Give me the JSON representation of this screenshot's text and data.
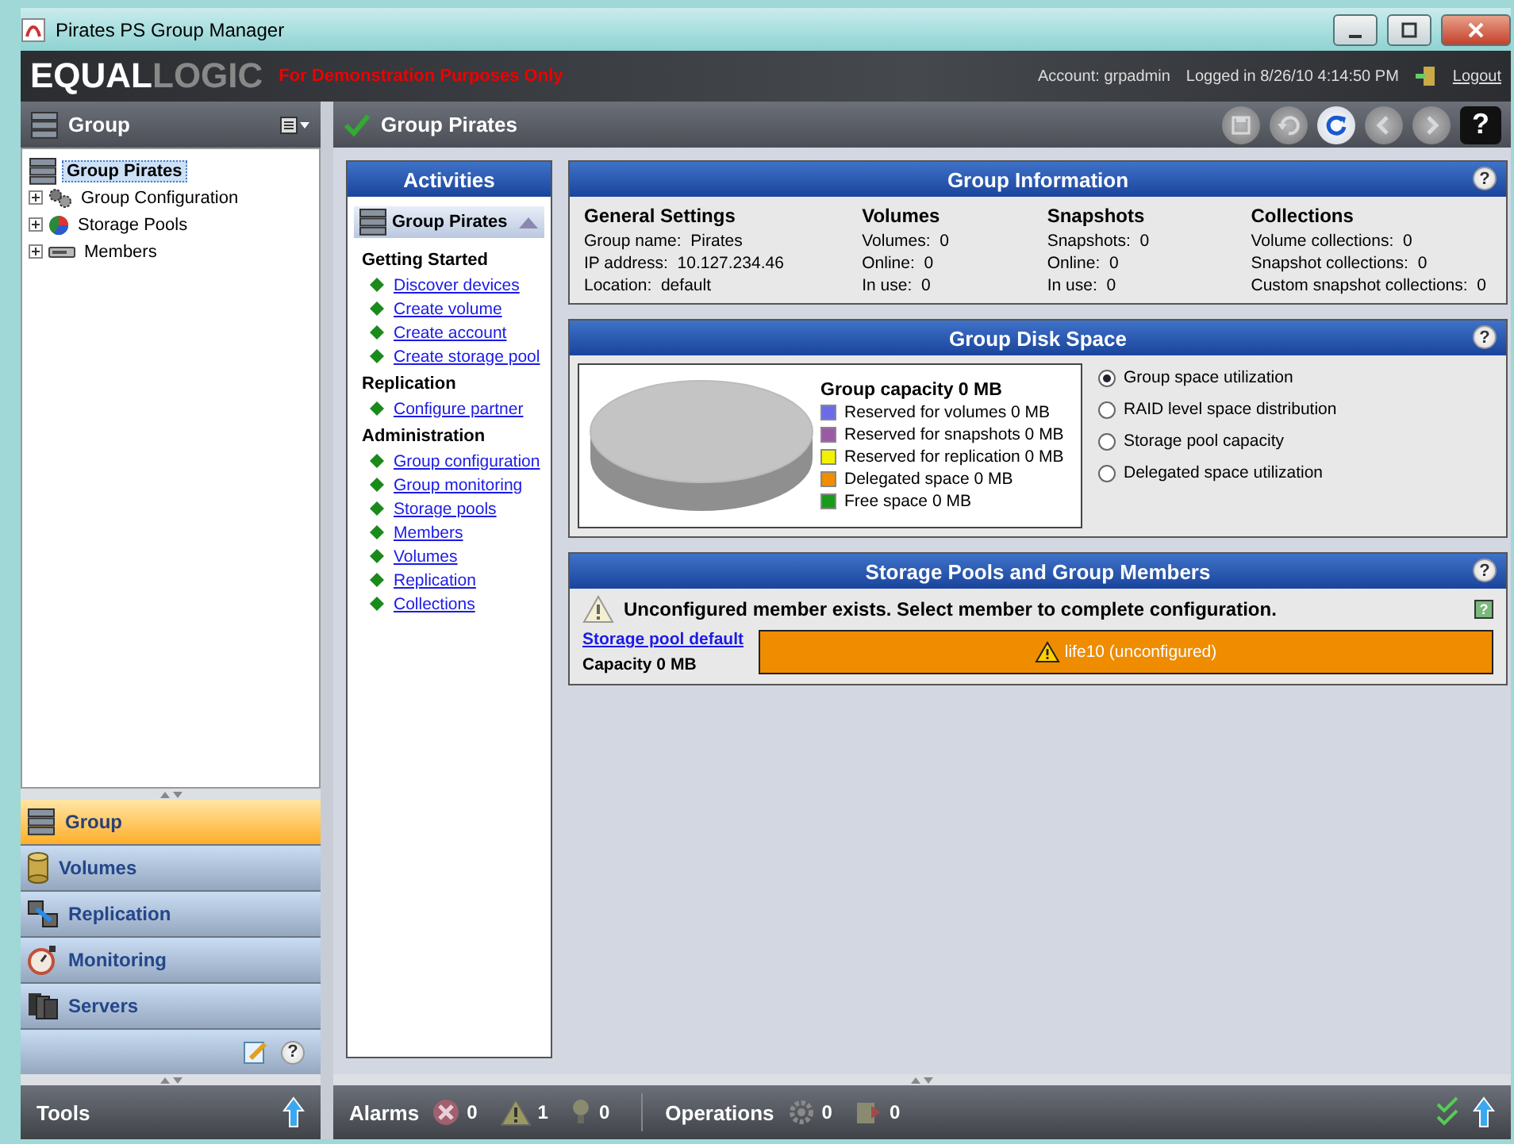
{
  "window": {
    "title": "Pirates PS Group Manager"
  },
  "brand": {
    "logo": [
      "EQUAL",
      "LOGIC"
    ],
    "notice": "For Demonstration Purposes Only",
    "account": "Account: grpadmin",
    "logged_in": "Logged in 8/26/10 4:14:50 PM",
    "logout": "Logout"
  },
  "left_header": {
    "title": "Group"
  },
  "tree": {
    "label": "Group Pirates",
    "selected": true,
    "children": [
      {
        "label": "Group Configuration",
        "kind": "configuration",
        "expanded": false
      },
      {
        "label": "Storage Pools",
        "kind": "pools",
        "expanded": false
      },
      {
        "label": "Members",
        "kind": "members",
        "expanded": false
      }
    ]
  },
  "nav": [
    {
      "label": "Group",
      "kind": "group",
      "selected": true
    },
    {
      "label": "Volumes",
      "kind": "volumes",
      "selected": false
    },
    {
      "label": "Replication",
      "kind": "replication",
      "selected": false
    },
    {
      "label": "Monitoring",
      "kind": "monitoring",
      "selected": false
    },
    {
      "label": "Servers",
      "kind": "servers",
      "selected": false
    }
  ],
  "tools": {
    "label": "Tools",
    "help": "?"
  },
  "content_header": {
    "title": "Group Pirates"
  },
  "toolbar": [
    {
      "kind": "save",
      "disabled": true
    },
    {
      "kind": "undo",
      "disabled": true
    },
    {
      "kind": "refresh",
      "disabled": false
    },
    {
      "kind": "back",
      "disabled": true
    },
    {
      "kind": "forward",
      "disabled": true
    },
    {
      "kind": "help",
      "disabled": false,
      "label": "?"
    }
  ],
  "activities": {
    "title": "Activities",
    "group": "Group Pirates",
    "sections": [
      {
        "heading": "Getting Started",
        "links": [
          "Discover devices",
          "Create volume",
          "Create account",
          "Create storage pool"
        ]
      },
      {
        "heading": "Replication",
        "links": [
          "Configure partner"
        ]
      },
      {
        "heading": "Administration",
        "links": [
          "Group configuration",
          "Group monitoring",
          "Storage pools",
          "Members",
          "Volumes",
          "Replication",
          "Collections"
        ]
      }
    ]
  },
  "group_information": {
    "title": "Group Information",
    "help": "?",
    "columns": [
      {
        "heading": "General Settings",
        "rows": [
          {
            "label": "Group name:",
            "value": "Pirates"
          },
          {
            "label": "IP address:",
            "value": "10.127.234.46"
          },
          {
            "label": "Location:",
            "value": "default"
          }
        ]
      },
      {
        "heading": "Volumes",
        "rows": [
          {
            "label": "Volumes:",
            "value": "0"
          },
          {
            "label": "Online:",
            "value": "0"
          },
          {
            "label": "In use:",
            "value": "0"
          }
        ]
      },
      {
        "heading": "Snapshots",
        "rows": [
          {
            "label": "Snapshots:",
            "value": "0"
          },
          {
            "label": "Online:",
            "value": "0"
          },
          {
            "label": "In use:",
            "value": "0"
          }
        ]
      },
      {
        "heading": "Collections",
        "rows": [
          {
            "label": "Volume collections:",
            "value": "0"
          },
          {
            "label": "Snapshot collections:",
            "value": "0"
          },
          {
            "label": "Custom snapshot collections:",
            "value": "0"
          }
        ]
      }
    ]
  },
  "group_disk_space": {
    "title": "Group Disk Space",
    "help": "?",
    "capacity": "Group capacity 0 MB",
    "legend": [
      {
        "label": "Reserved for volumes 0 MB",
        "color": "#6b6bea"
      },
      {
        "label": "Reserved for snapshots 0 MB",
        "color": "#9c5aa6"
      },
      {
        "label": "Reserved for replication 0 MB",
        "color": "#f2f200"
      },
      {
        "label": "Delegated space 0 MB",
        "color": "#f08c00"
      },
      {
        "label": "Free space 0 MB",
        "color": "#1a9a1a"
      }
    ],
    "options": [
      {
        "label": "Group space utilization",
        "selected": true
      },
      {
        "label": "RAID level space distribution",
        "selected": false
      },
      {
        "label": "Storage pool capacity",
        "selected": false
      },
      {
        "label": "Delegated space utilization",
        "selected": false
      }
    ]
  },
  "storage_pools": {
    "title": "Storage Pools and Group Members",
    "help": "?",
    "info": "?",
    "warning": "Unconfigured member exists. Select member to complete configuration.",
    "pool_link": "Storage pool default",
    "capacity": "Capacity 0 MB",
    "member": "life10 (unconfigured)"
  },
  "status_bar": {
    "alarms_label": "Alarms",
    "alarms": [
      {
        "kind": "critical",
        "count": "0"
      },
      {
        "kind": "warning",
        "count": "1"
      },
      {
        "kind": "info",
        "count": "0"
      }
    ],
    "operations_label": "Operations",
    "operations": [
      {
        "kind": "running",
        "count": "0"
      },
      {
        "kind": "failed",
        "count": "0"
      }
    ]
  }
}
